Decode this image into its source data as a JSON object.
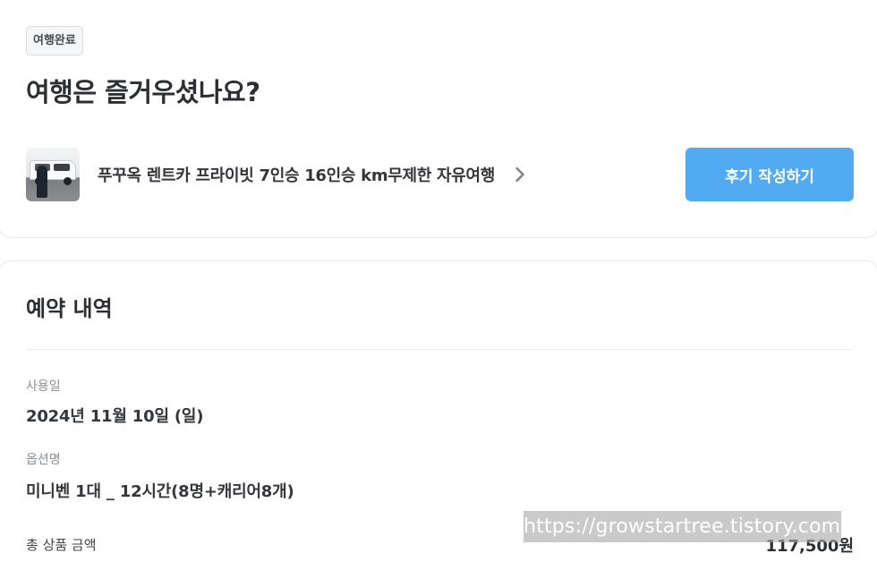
{
  "trip": {
    "badge": "여행완료",
    "title": "여행은 즐거우셨나요?",
    "product_name": "푸꾸옥 렌트카 프라이빗 7인승 16인승 km무제한 자유여행",
    "review_button": "후기 작성하기"
  },
  "reservation": {
    "title": "예약 내역",
    "use_date_label": "사용일",
    "use_date_value": "2024년 11월 10일 (일)",
    "option_label": "옵션명",
    "option_value": "미니벤 1대 _ 12시간(8명+캐리어8개)",
    "total_label": "총 상품 금액",
    "total_value": "117,500원"
  },
  "watermark": {
    "text": "https://growstartree.tistory.com"
  },
  "icons": {
    "chevron": "chevron-right-icon",
    "thumbnail": "van-photo"
  },
  "colors": {
    "accent": "#51aaf2",
    "text_primary": "#2b2f33",
    "text_muted": "#8a8f95",
    "border": "#e7e9ec"
  }
}
